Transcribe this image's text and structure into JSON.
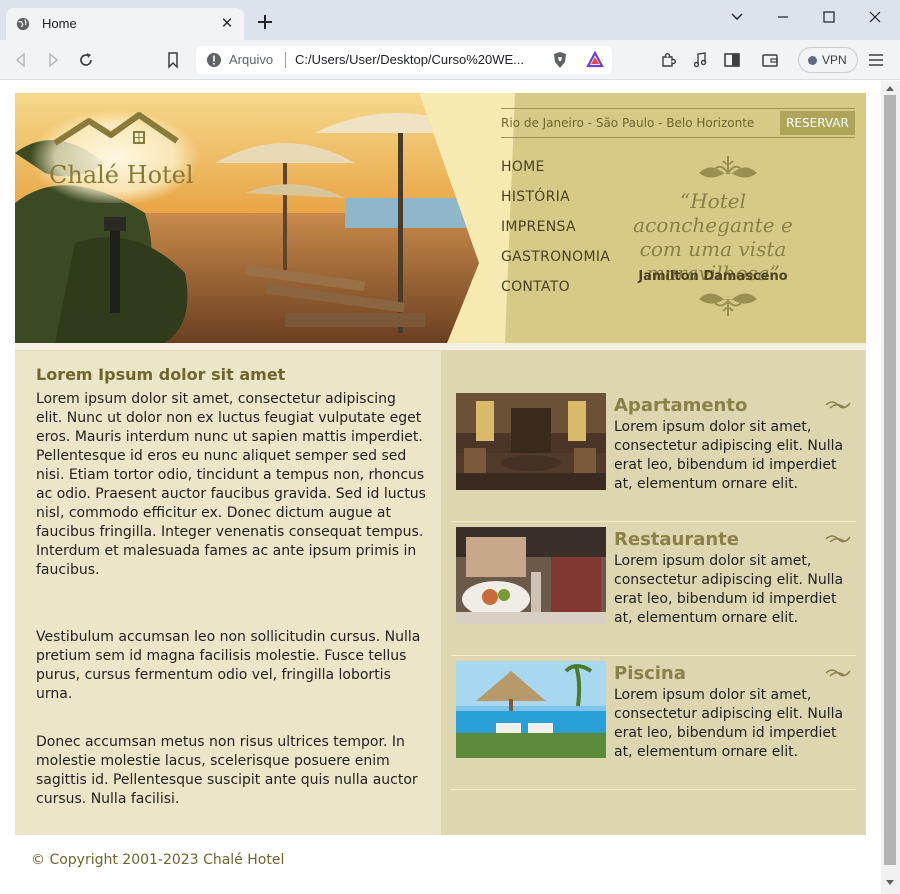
{
  "browser": {
    "tab_title": "Home",
    "address_label": "Arquivo",
    "url": "C:/Users/User/Desktop/Curso%20WE...",
    "vpn_label": "VPN"
  },
  "site": {
    "logo_text": "Chalé Hotel",
    "cities": "Rio de Janeiro - São Paulo - Belo Horizonte",
    "reserve_label": "RESERVAR",
    "nav": [
      "HOME",
      "HISTÓRIA",
      "IMPRENSA",
      "GASTRONOMIA",
      "CONTATO"
    ],
    "quote": "“Hotel aconchegante e com uma vista maravilhosa”",
    "quote_author": "Jamilton Damasceno"
  },
  "main": {
    "title": "Lorem Ipsum dolor sit amet",
    "paragraphs": [
      "Lorem ipsum dolor sit amet, consectetur adipiscing elit. Nunc ut dolor non ex luctus feugiat vulputate eget eros. Mauris interdum nunc ut sapien mattis imperdiet. Pellentesque id eros eu nunc aliquet semper sed sed nisi. Etiam tortor odio, tincidunt a tempus non, rhoncus ac odio. Praesent auctor faucibus gravida. Sed id luctus nisl, commodo efficitur ex. Donec dictum augue at faucibus fringilla. Integer venenatis consequat tempus. Interdum et malesuada fames ac ante ipsum primis in faucibus.",
      "Vestibulum accumsan leo non sollicitudin cursus. Nulla pretium sem id magna facilisis molestie. Fusce tellus purus, cursus fermentum odio vel, fringilla lobortis urna.",
      "Donec accumsan metus non risus ultrices tempor. In molestie molestie lacus, scelerisque posuere enim sagittis id. Pellentesque suscipit ante quis nulla auctor cursus. Nulla facilisi."
    ]
  },
  "features": [
    {
      "title": "Apartamento",
      "text": "Lorem ipsum dolor sit amet, consectetur adipiscing elit. Nulla erat leo, bibendum id imperdiet at, elementum ornare elit."
    },
    {
      "title": "Restaurante",
      "text": "Lorem ipsum dolor sit amet, consectetur adipiscing elit. Nulla erat leo, bibendum id imperdiet at, elementum ornare elit."
    },
    {
      "title": "Piscina",
      "text": "Lorem ipsum dolor sit amet, consectetur adipiscing elit. Nulla erat leo, bibendum id imperdiet at, elementum ornare elit."
    }
  ],
  "footer": {
    "copyright": "© Copyright 2001-2023 Chalé Hotel"
  }
}
